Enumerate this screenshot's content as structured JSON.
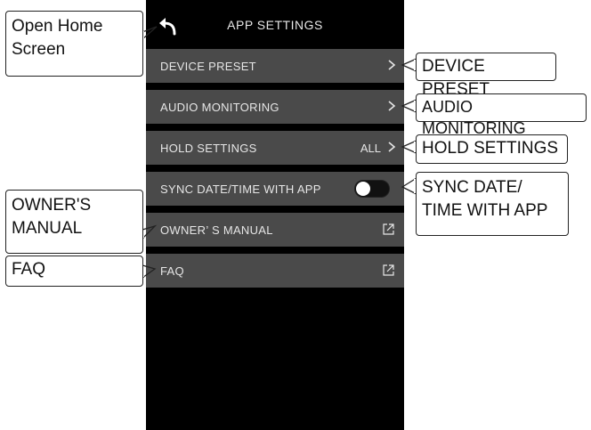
{
  "app": {
    "title": "APP SETTINGS",
    "back_icon": "back-arrow-icon"
  },
  "rows": [
    {
      "label": "DEVICE PRESET",
      "value": "",
      "accessory": "chevron-right-icon"
    },
    {
      "label": "AUDIO MONITORING",
      "value": "",
      "accessory": "chevron-right-icon"
    },
    {
      "label": "HOLD SETTINGS",
      "value": "ALL",
      "accessory": "chevron-right-icon"
    },
    {
      "label": "SYNC DATE/TIME WITH APP",
      "value": "",
      "accessory": "toggle",
      "toggle_on": false
    },
    {
      "label": "OWNER’ S MANUAL",
      "value": "",
      "accessory": "external-link-icon"
    },
    {
      "label": "FAQ",
      "value": "",
      "accessory": "external-link-icon"
    }
  ],
  "callouts": {
    "open_home": [
      "Open Home",
      "Screen"
    ],
    "device_preset": [
      "DEVICE PRESET"
    ],
    "audio_monitoring": [
      "AUDIO MONITORING"
    ],
    "hold_settings": [
      "HOLD SETTINGS"
    ],
    "sync_date": [
      "SYNC DATE/",
      "TIME WITH APP"
    ],
    "owners_manual": [
      "OWNER'S",
      "MANUAL"
    ],
    "faq": [
      "FAQ"
    ]
  },
  "colors": {
    "screen_bg": "#000000",
    "row_bg": "#4a4a4a",
    "row_text": "#e6e6e6"
  }
}
